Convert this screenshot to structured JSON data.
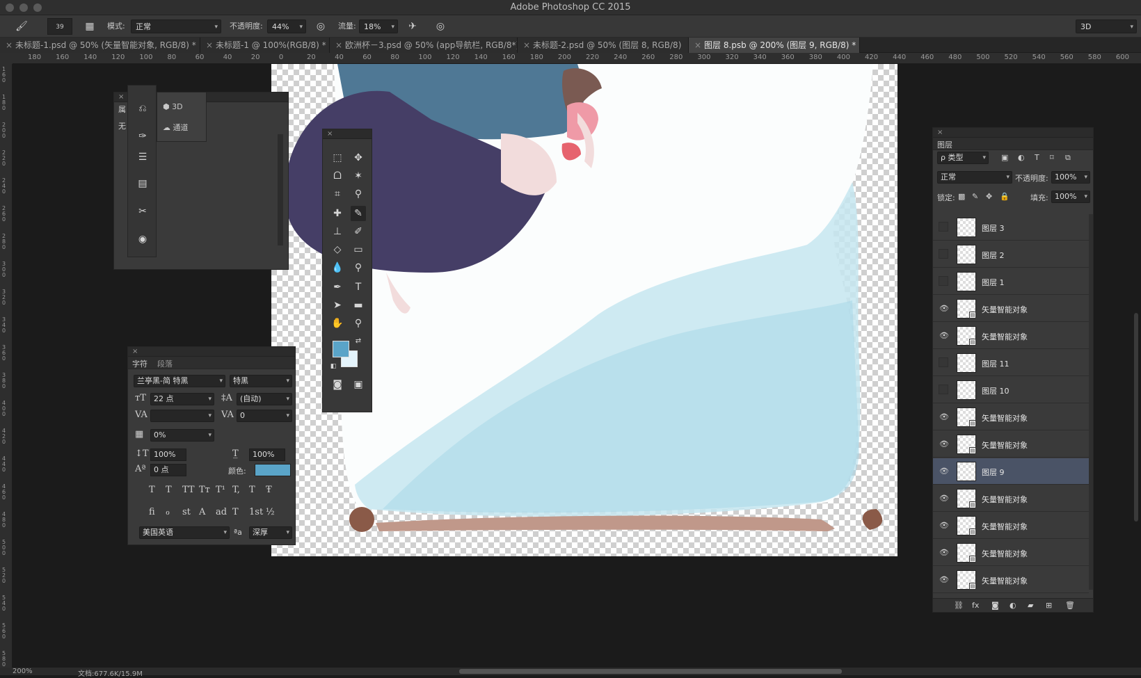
{
  "window": {
    "title": "Adobe Photoshop CC 2015"
  },
  "options_bar": {
    "brush_size": "39",
    "mode_label": "模式:",
    "mode_value": "正常",
    "opacity_label": "不透明度:",
    "opacity_value": "44%",
    "flow_label": "流量:",
    "flow_value": "18%",
    "workspace": "3D"
  },
  "tabs": [
    {
      "label": "未标题-1.psd @ 50% (矢量智能对象, RGB/8) *"
    },
    {
      "label": "未标题-1 @ 100%(RGB/8) *"
    },
    {
      "label": "欧洲杯－3.psd @ 50% (app导航栏, RGB/8*)"
    },
    {
      "label": "未标题-2.psd @ 50% (图层 8, RGB/8)"
    },
    {
      "label": "图层 8.psb @ 200% (图层 9, RGB/8) *"
    }
  ],
  "ruler_top": [
    "180",
    "160",
    "140",
    "120",
    "100",
    "80",
    "60",
    "40",
    "20",
    "0",
    "20",
    "40",
    "60",
    "80",
    "100",
    "120",
    "140",
    "160",
    "180",
    "200",
    "220",
    "240",
    "260",
    "280",
    "300",
    "320",
    "340",
    "360",
    "380",
    "400",
    "420",
    "440",
    "460",
    "480",
    "500",
    "520",
    "540",
    "560",
    "580",
    "600"
  ],
  "ruler_left": [
    "160",
    "180",
    "200",
    "220",
    "240",
    "260",
    "280",
    "300",
    "320",
    "340",
    "360",
    "380",
    "400",
    "420",
    "440",
    "460",
    "480",
    "500",
    "520",
    "540",
    "560",
    "580"
  ],
  "mini_panel": {
    "label_3d": "3D",
    "label_channels": "通道",
    "label_properties_short": "属",
    "label_none_short": "无"
  },
  "character_panel": {
    "tab_character": "字符",
    "tab_paragraph": "段落",
    "font_family": "兰亭黑-简 特黑",
    "font_style": "特黑",
    "font_size": "22 点",
    "leading": "(自动)",
    "kerning": "",
    "tracking": "0",
    "tsume": "0%",
    "vertical_scale": "100%",
    "horizontal_scale": "100%",
    "baseline_shift": "0 点",
    "color_label": "颜色:",
    "color_value": "#5aa4c8",
    "language": "美国英语",
    "aa_label": "ªa",
    "antialias": "深厚",
    "style_buttons": [
      "T",
      "T",
      "TT",
      "Tт",
      "T¹",
      "T,",
      "T",
      "Ŧ"
    ],
    "opentype_buttons": [
      "ﬁ",
      "ℴ",
      "st",
      "A",
      "ad",
      "T",
      "1st",
      "½"
    ]
  },
  "tools": {
    "foreground": "#5aa4c8",
    "background": "#e4f4fb"
  },
  "layers_panel": {
    "title": "图层",
    "filter_kind": "ρ 类型",
    "blend_mode": "正常",
    "opacity_label": "不透明度:",
    "opacity_value": "100%",
    "lock_label": "锁定:",
    "fill_label": "填充:",
    "fill_value": "100%",
    "layers": [
      {
        "name": "图层 3",
        "visible": false,
        "smart": false,
        "selected": false
      },
      {
        "name": "图层 2",
        "visible": false,
        "smart": false,
        "selected": false
      },
      {
        "name": "图层 1",
        "visible": false,
        "smart": false,
        "selected": false
      },
      {
        "name": "矢量智能对象",
        "visible": true,
        "smart": true,
        "selected": false
      },
      {
        "name": "矢量智能对象",
        "visible": true,
        "smart": true,
        "selected": false
      },
      {
        "name": "图层 11",
        "visible": false,
        "smart": false,
        "selected": false
      },
      {
        "name": "图层 10",
        "visible": false,
        "smart": false,
        "selected": false
      },
      {
        "name": "矢量智能对象",
        "visible": true,
        "smart": true,
        "selected": false
      },
      {
        "name": "矢量智能对象",
        "visible": true,
        "smart": true,
        "selected": false
      },
      {
        "name": "图层 9",
        "visible": true,
        "smart": false,
        "selected": true
      },
      {
        "name": "矢量智能对象",
        "visible": true,
        "smart": true,
        "selected": false
      },
      {
        "name": "矢量智能对象",
        "visible": true,
        "smart": true,
        "selected": false
      },
      {
        "name": "矢量智能对象",
        "visible": true,
        "smart": true,
        "selected": false
      },
      {
        "name": "矢量智能对象",
        "visible": true,
        "smart": true,
        "selected": false
      }
    ]
  },
  "status": {
    "zoom": "200%",
    "doc_info": "文档:677.6K/15.9M"
  }
}
